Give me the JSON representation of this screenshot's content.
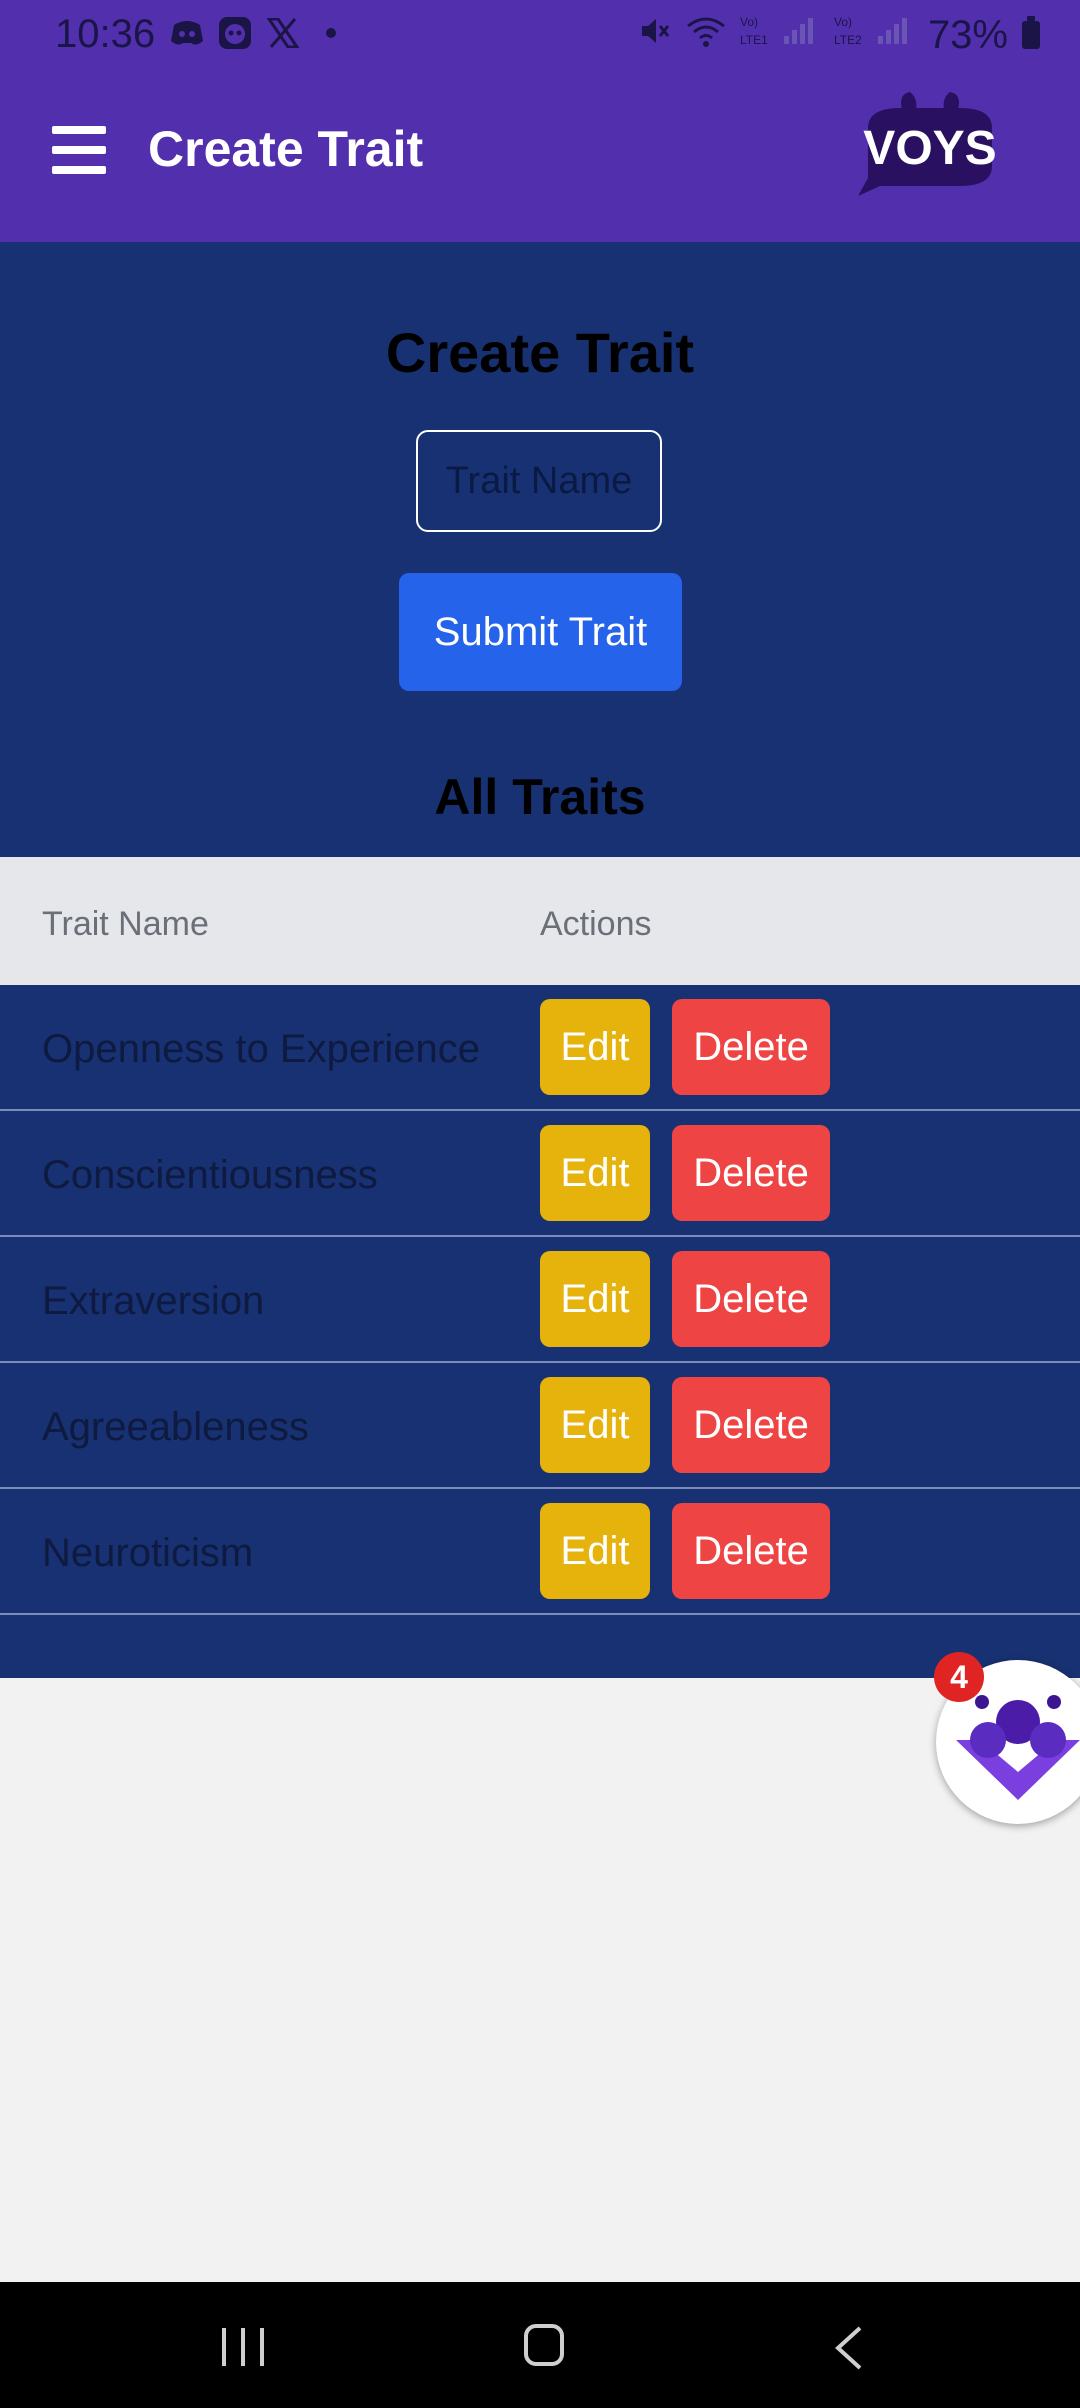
{
  "status_bar": {
    "time": "10:36",
    "battery": "73%",
    "icons": [
      "discord-icon",
      "bot-icon",
      "x-icon",
      "dot-icon",
      "mute-icon",
      "wifi-icon",
      "lte1-signal-icon",
      "lte2-signal-icon",
      "battery-icon"
    ]
  },
  "app_bar": {
    "title": "Create Trait",
    "logo_text": "VOYS",
    "colors": {
      "background": "#5230ad"
    }
  },
  "form": {
    "heading": "Create Trait",
    "trait_name_placeholder": "Trait Name",
    "trait_name_value": "",
    "submit_label": "Submit Trait"
  },
  "traits": {
    "heading": "All Traits",
    "columns": [
      "Trait Name",
      "Actions"
    ],
    "rows": [
      {
        "name": "Openness to Experience",
        "edit_label": "Edit",
        "delete_label": "Delete"
      },
      {
        "name": "Conscientiousness",
        "edit_label": "Edit",
        "delete_label": "Delete"
      },
      {
        "name": "Extraversion",
        "edit_label": "Edit",
        "delete_label": "Delete"
      },
      {
        "name": "Agreeableness",
        "edit_label": "Edit",
        "delete_label": "Delete"
      },
      {
        "name": "Neuroticism",
        "edit_label": "Edit",
        "delete_label": "Delete"
      }
    ]
  },
  "chat_bubble": {
    "badge_count": "4"
  },
  "colors": {
    "panel": "#183172",
    "submit": "#2563eb",
    "edit": "#e6b20c",
    "delete": "#ef4444",
    "table_header": "#e5e7eb"
  },
  "nav_bar": {
    "buttons": [
      "recent-apps",
      "home",
      "back"
    ]
  }
}
